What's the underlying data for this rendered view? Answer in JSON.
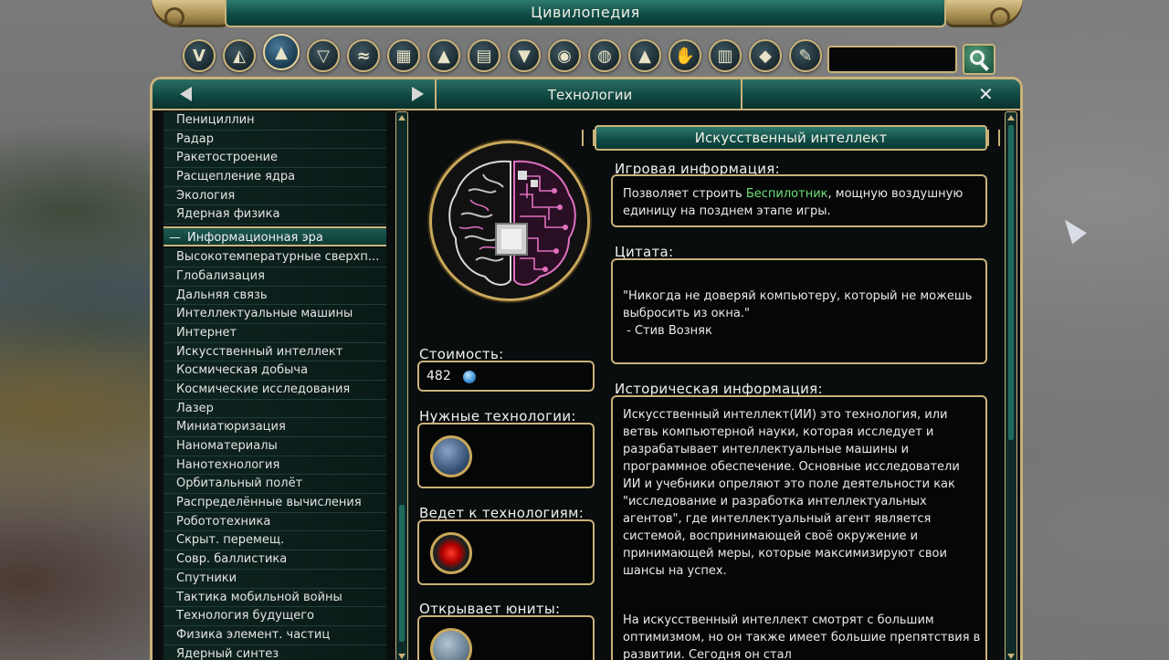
{
  "window": {
    "title": "Цивилопедия"
  },
  "categories": [
    {
      "name": "game-concepts-icon",
      "glyph": "V"
    },
    {
      "name": "civs-icon",
      "glyph": "◭"
    },
    {
      "name": "tech-icon",
      "glyph": "▲",
      "active": true
    },
    {
      "name": "policies-icon",
      "glyph": "▽"
    },
    {
      "name": "promotions-icon",
      "glyph": "≈"
    },
    {
      "name": "buildings-icon",
      "glyph": "▦"
    },
    {
      "name": "wonders-icon",
      "glyph": "▲"
    },
    {
      "name": "units-icon",
      "glyph": "▤"
    },
    {
      "name": "specialists-icon",
      "glyph": "▼"
    },
    {
      "name": "city-states-icon",
      "glyph": "◉"
    },
    {
      "name": "great-people-icon",
      "glyph": "◍"
    },
    {
      "name": "terrain-icon",
      "glyph": "▲"
    },
    {
      "name": "resources-icon",
      "glyph": "✋"
    },
    {
      "name": "improvements-icon",
      "glyph": "▥"
    },
    {
      "name": "religion-icon",
      "glyph": "◆"
    },
    {
      "name": "world-congress-icon",
      "glyph": "✎"
    }
  ],
  "search": {
    "value": ""
  },
  "nav": {
    "title": "Технологии",
    "close_label": "✕"
  },
  "list": {
    "items_before": [
      "Пенициллин",
      "Радар",
      "Ракетостроение",
      "Расщепление ядра",
      "Экология",
      "Ядерная физика"
    ],
    "section": {
      "label": "Информационная эра",
      "collapse_glyph": "—"
    },
    "items_after": [
      "Высокотемпературные сверхп...",
      "Глобализация",
      "Дальняя связь",
      "Интеллектуальные машины",
      "Интернет",
      "Искусственный интеллект",
      "Космическая добыча",
      "Космические исследования",
      "Лазер",
      "Миниатюризация",
      "Наноматериалы",
      "Нанотехнология",
      "Орбитальный полёт",
      "Распределённые вычисления",
      "Робототехника",
      "Скрыт. перемещ.",
      "Совр. баллистика",
      "Спутники",
      "Тактика мобильной войны",
      "Технология будущего",
      "Физика элемент. частиц",
      "Ядерный синтез"
    ]
  },
  "tech": {
    "name": "Искусственный интеллект",
    "cost_label": "Стоимость:",
    "cost_value": "482",
    "prereq_label": "Нужные технологии:",
    "leads_to_label": "Ведет к технологиям:",
    "unlocks_units_label": "Открывает юниты:",
    "game_info_label": "Игровая информация:",
    "game_info": {
      "before": "Позволяет строить ",
      "link": "Беспилотник",
      "after": ", мощную воздушную единицу на позднем этапе игры."
    },
    "quote_label": "Цитата:",
    "quote_text": "\"Никогда не доверяй компьютеру, который не можешь выбросить из окна.\"",
    "quote_author": " - Стив Возняк",
    "history_label": "Историческая информация:",
    "history_p1": "Искусственный интеллект(ИИ) это технология, или ветвь компьютерной науки, которая исследует и разрабатывает интеллектуальные машины и программное обеспечение. Основные исследователи ИИ и учебники опреляют это поле деятельности как \"исследование и разработка интеллектуальных агентов\", где интеллектуальный агент является системой, воспринимающей своё окружение и принимающей меры, которые максимизируют свои шансы на успех.",
    "history_p2": "На искусственный интеллект смотрят с большим оптимизмом, но он также имеет большие препятствия в развитии. Сегодня он стал"
  },
  "colors": {
    "gold": "#c9b27a",
    "teal": "#0f4a44",
    "link_green": "#6be07a"
  }
}
